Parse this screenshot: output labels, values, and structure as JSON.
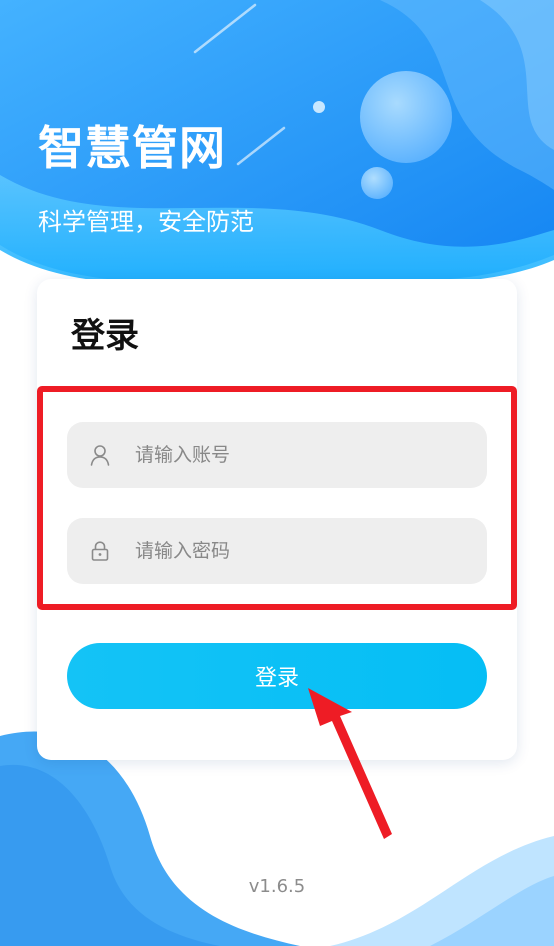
{
  "header": {
    "app_title": "智慧管网",
    "subtitle": "科学管理，安全防范"
  },
  "login": {
    "title": "登录",
    "account_placeholder": "请输入账号",
    "password_placeholder": "请输入密码",
    "submit_label": "登录"
  },
  "footer": {
    "version": "v1.6.5"
  },
  "icons": {
    "account": "user-icon",
    "password": "lock-icon"
  },
  "colors": {
    "hero_gradient_start": "#3aa7ff",
    "hero_gradient_end": "#1686f4",
    "button": "#07bff5",
    "field_background": "#eeeeee",
    "highlight": "#ee1c25",
    "annotation_arrow": "#ee1c25"
  }
}
